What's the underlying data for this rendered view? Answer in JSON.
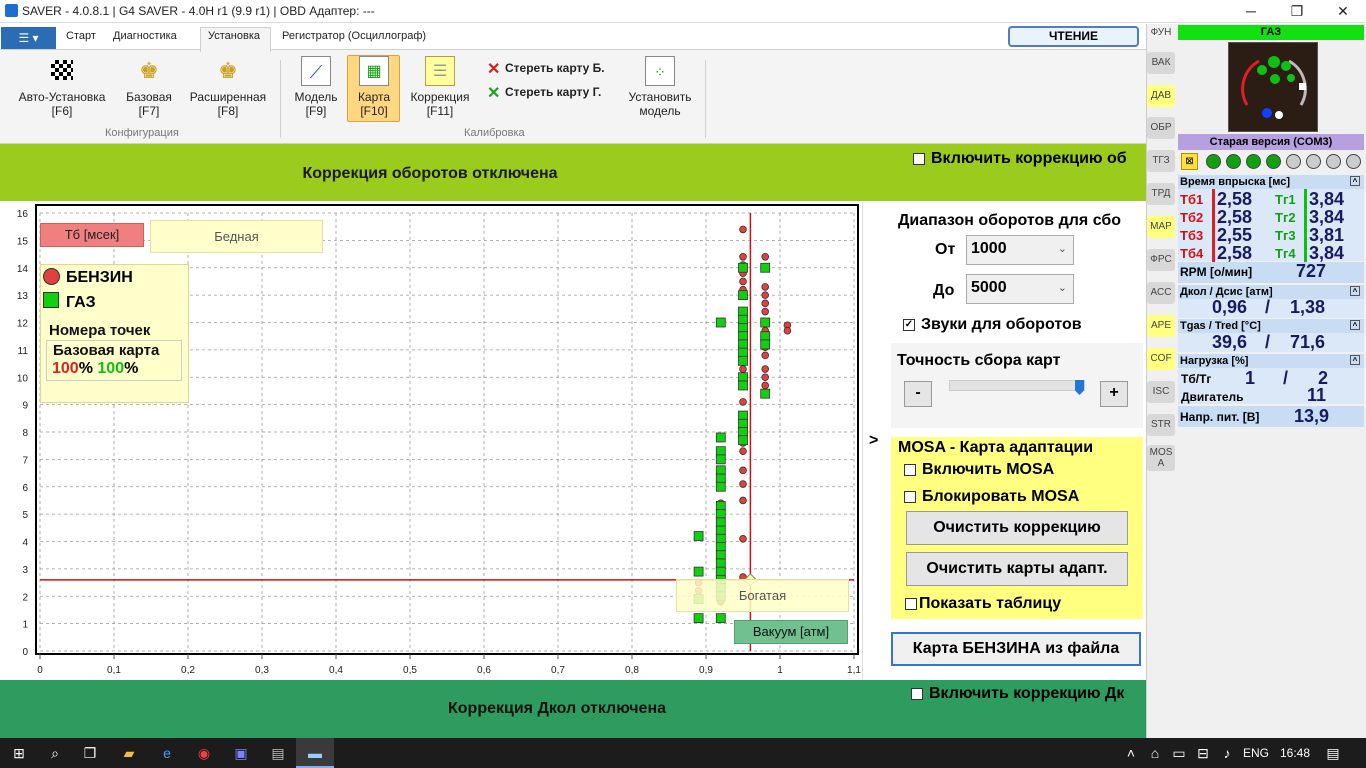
{
  "window": {
    "title": "SAVER - 4.0.8.1  |  G4 SAVER - 4.0H r1 (9.9 r1)  |  OBD Адаптер: ---",
    "minimize": "─",
    "maximize": "❐",
    "close": "✕"
  },
  "ribbon": {
    "menu_label": "☰ ▾",
    "tabs": [
      "Старт",
      "Диагностика",
      "Установка",
      "Регистратор (Осциллограф)"
    ],
    "active_tab": "Установка",
    "read_button": "ЧТЕНИЕ",
    "buttons": [
      {
        "label": "Авто-Установка",
        "key": "[F6]"
      },
      {
        "label": "Базовая",
        "key": "[F7]"
      },
      {
        "label": "Расширенная",
        "key": "[F8]"
      },
      {
        "label": "Модель",
        "key": "[F9]"
      },
      {
        "label": "Карта",
        "key": "[F10]"
      },
      {
        "label": "Коррекция",
        "key": "[F11]"
      },
      {
        "label": "Установить",
        "key": "модель"
      }
    ],
    "erase_b": "Стереть карту Б.",
    "erase_g": "Стереть карту Г.",
    "group_config": "Конфигурация",
    "group_calib": "Калибровка"
  },
  "top_band": {
    "status": "Коррекция оборотов отключена",
    "checkbox": "Включить коррекцию об"
  },
  "bottom_band": {
    "status": "Коррекция Дкол отключена",
    "checkbox": "Включить коррекцию Дк"
  },
  "chart_overlay": {
    "tb_label": "Тб [мсек]",
    "lean_label": "Бедная",
    "rich_label": "Богатая",
    "vac_label": "Вакуум [атм]",
    "legend_benzin": "БЕНЗИН",
    "legend_gaz": "ГАЗ",
    "points_title": "Номера точек",
    "base_map": "Базовая карта",
    "pct_b": "100",
    "pct_g": "100",
    "pct_sign": "%",
    "expand_arrow": ">"
  },
  "chart_data": {
    "type": "scatter",
    "xlim": [
      0,
      1.1
    ],
    "ylim": [
      0,
      16
    ],
    "x_ticks": [
      "0",
      "0,1",
      "0,2",
      "0,3",
      "0,4",
      "0,5",
      "0,6",
      "0,7",
      "0,8",
      "0,9",
      "1",
      "1,1"
    ],
    "y_ticks": [
      "0",
      "1",
      "2",
      "3",
      "4",
      "5",
      "6",
      "7",
      "8",
      "9",
      "10",
      "11",
      "12",
      "13",
      "14",
      "15",
      "16"
    ],
    "grid": true,
    "red_vertical_x": 0.96,
    "red_horizontal_y": 2.6,
    "series": [
      {
        "name": "БЕНЗИН",
        "color": "#e04040",
        "marker": "circle",
        "points": [
          [
            0.89,
            2.5
          ],
          [
            0.89,
            2.2
          ],
          [
            0.89,
            1.9
          ],
          [
            0.92,
            5.4
          ],
          [
            0.92,
            5.1
          ],
          [
            0.92,
            4.8
          ],
          [
            0.92,
            4.5
          ],
          [
            0.92,
            4.2
          ],
          [
            0.92,
            3.9
          ],
          [
            0.92,
            3.6
          ],
          [
            0.92,
            3.3
          ],
          [
            0.92,
            3.0
          ],
          [
            0.92,
            2.7
          ],
          [
            0.92,
            2.4
          ],
          [
            0.92,
            2.1
          ],
          [
            0.92,
            1.8
          ],
          [
            0.95,
            15.4
          ],
          [
            0.95,
            14.4
          ],
          [
            0.95,
            14.1
          ],
          [
            0.95,
            13.8
          ],
          [
            0.95,
            13.5
          ],
          [
            0.95,
            13.2
          ],
          [
            0.95,
            12.4
          ],
          [
            0.95,
            12.1
          ],
          [
            0.95,
            11.8
          ],
          [
            0.95,
            11.5
          ],
          [
            0.95,
            11.2
          ],
          [
            0.95,
            10.9
          ],
          [
            0.95,
            10.6
          ],
          [
            0.95,
            10.3
          ],
          [
            0.95,
            10.0
          ],
          [
            0.95,
            9.7
          ],
          [
            0.95,
            9.1
          ],
          [
            0.95,
            8.5
          ],
          [
            0.95,
            8.2
          ],
          [
            0.95,
            7.9
          ],
          [
            0.95,
            7.6
          ],
          [
            0.95,
            7.3
          ],
          [
            0.95,
            6.6
          ],
          [
            0.95,
            6.1
          ],
          [
            0.95,
            5.5
          ],
          [
            0.95,
            4.1
          ],
          [
            0.95,
            2.7
          ],
          [
            0.98,
            14.4
          ],
          [
            0.98,
            13.3
          ],
          [
            0.98,
            13.0
          ],
          [
            0.98,
            12.7
          ],
          [
            0.98,
            12.4
          ],
          [
            0.98,
            12.0
          ],
          [
            0.98,
            11.7
          ],
          [
            0.98,
            11.4
          ],
          [
            0.98,
            11.1
          ],
          [
            0.98,
            10.8
          ],
          [
            0.98,
            10.3
          ],
          [
            0.98,
            10.0
          ],
          [
            0.98,
            9.7
          ],
          [
            0.98,
            9.4
          ],
          [
            1.01,
            11.9
          ],
          [
            1.01,
            11.7
          ]
        ]
      },
      {
        "name": "ГАЗ",
        "color": "#10d010",
        "marker": "square",
        "points": [
          [
            0.89,
            4.2
          ],
          [
            0.89,
            2.9
          ],
          [
            0.89,
            1.9
          ],
          [
            0.89,
            1.2
          ],
          [
            0.92,
            12.0
          ],
          [
            0.92,
            7.8
          ],
          [
            0.92,
            7.3
          ],
          [
            0.92,
            7.0
          ],
          [
            0.92,
            6.6
          ],
          [
            0.92,
            6.3
          ],
          [
            0.92,
            6.0
          ],
          [
            0.92,
            5.3
          ],
          [
            0.92,
            5.0
          ],
          [
            0.92,
            4.7
          ],
          [
            0.92,
            4.4
          ],
          [
            0.92,
            4.1
          ],
          [
            0.92,
            3.8
          ],
          [
            0.92,
            3.5
          ],
          [
            0.92,
            3.2
          ],
          [
            0.92,
            2.9
          ],
          [
            0.92,
            2.6
          ],
          [
            0.92,
            2.3
          ],
          [
            0.92,
            2.0
          ],
          [
            0.92,
            1.2
          ],
          [
            0.95,
            14.0
          ],
          [
            0.95,
            13.0
          ],
          [
            0.95,
            12.4
          ],
          [
            0.95,
            12.1
          ],
          [
            0.95,
            11.8
          ],
          [
            0.95,
            11.5
          ],
          [
            0.95,
            11.2
          ],
          [
            0.95,
            10.9
          ],
          [
            0.95,
            10.6
          ],
          [
            0.95,
            10.0
          ],
          [
            0.95,
            9.7
          ],
          [
            0.95,
            8.6
          ],
          [
            0.95,
            8.3
          ],
          [
            0.95,
            8.0
          ],
          [
            0.95,
            7.7
          ],
          [
            0.98,
            14.0
          ],
          [
            0.98,
            12.0
          ],
          [
            0.98,
            11.5
          ],
          [
            0.98,
            11.2
          ],
          [
            0.98,
            9.4
          ]
        ]
      }
    ]
  },
  "rpm": {
    "range_title": "Диапазон оборотов для сбо",
    "from_label": "От",
    "from_value": "1000",
    "to_label": "До",
    "to_value": "5000",
    "chevron": "⌄",
    "sounds_label": "Звуки для оборотов",
    "sounds_checked": true,
    "precision_title": "Точность сбора карт",
    "minus": "-",
    "plus": "+",
    "slider_value": 1.0
  },
  "mosa": {
    "title": "MOSA - Карта адаптации",
    "enable": "Включить MOSA",
    "block": "Блокировать MOSA",
    "clear_corr": "Очистить коррекцию",
    "clear_maps": "Очистить карты адапт.",
    "show_table": "Показать таблицу"
  },
  "file_button": "Карта БЕНЗИНА из файла",
  "sidenav": [
    "ФУН",
    "ВАК",
    "ДАВ",
    "ОБР",
    "ТГЗ",
    "ТРД",
    "MAP",
    "ФРС",
    "АСС",
    "АРЕ",
    "COF",
    "ISC",
    "STR",
    "MOS\nA"
  ],
  "right": {
    "gaz": "ГАЗ",
    "version": "Старая версия (COM3)",
    "inj_header": "Время впрыска [мс]",
    "tb": [
      {
        "l": "Тб1",
        "v": "2,58"
      },
      {
        "l": "Тб2",
        "v": "2,58"
      },
      {
        "l": "Тб3",
        "v": "2,55"
      },
      {
        "l": "Тб4",
        "v": "2,58"
      }
    ],
    "tg": [
      {
        "l": "Тг1",
        "v": "3,84"
      },
      {
        "l": "Тг2",
        "v": "3,84"
      },
      {
        "l": "Тг3",
        "v": "3,81"
      },
      {
        "l": "Тг4",
        "v": "3,84"
      }
    ],
    "rpm_label": "RPM [о/мин]",
    "rpm_value": "727",
    "press_header": "Дкол / Дсис [атм]",
    "p1": "0,96",
    "p2": "1,38",
    "temp_header": "Tgas / Tred [°C]",
    "t1": "39,6",
    "t2": "71,6",
    "load_header": "Нагрузка [%]",
    "load_tbtg_label": "Тб/Тг",
    "load_tb": "1",
    "load_tg": "2",
    "engine_label": "Двигатель",
    "engine_value": "11",
    "volt_label": "Напр. пит. [В]",
    "volt_value": "13,9",
    "slash": "/",
    "expand": "^"
  },
  "taskbar": {
    "lang": "ENG",
    "time": "16:48"
  }
}
